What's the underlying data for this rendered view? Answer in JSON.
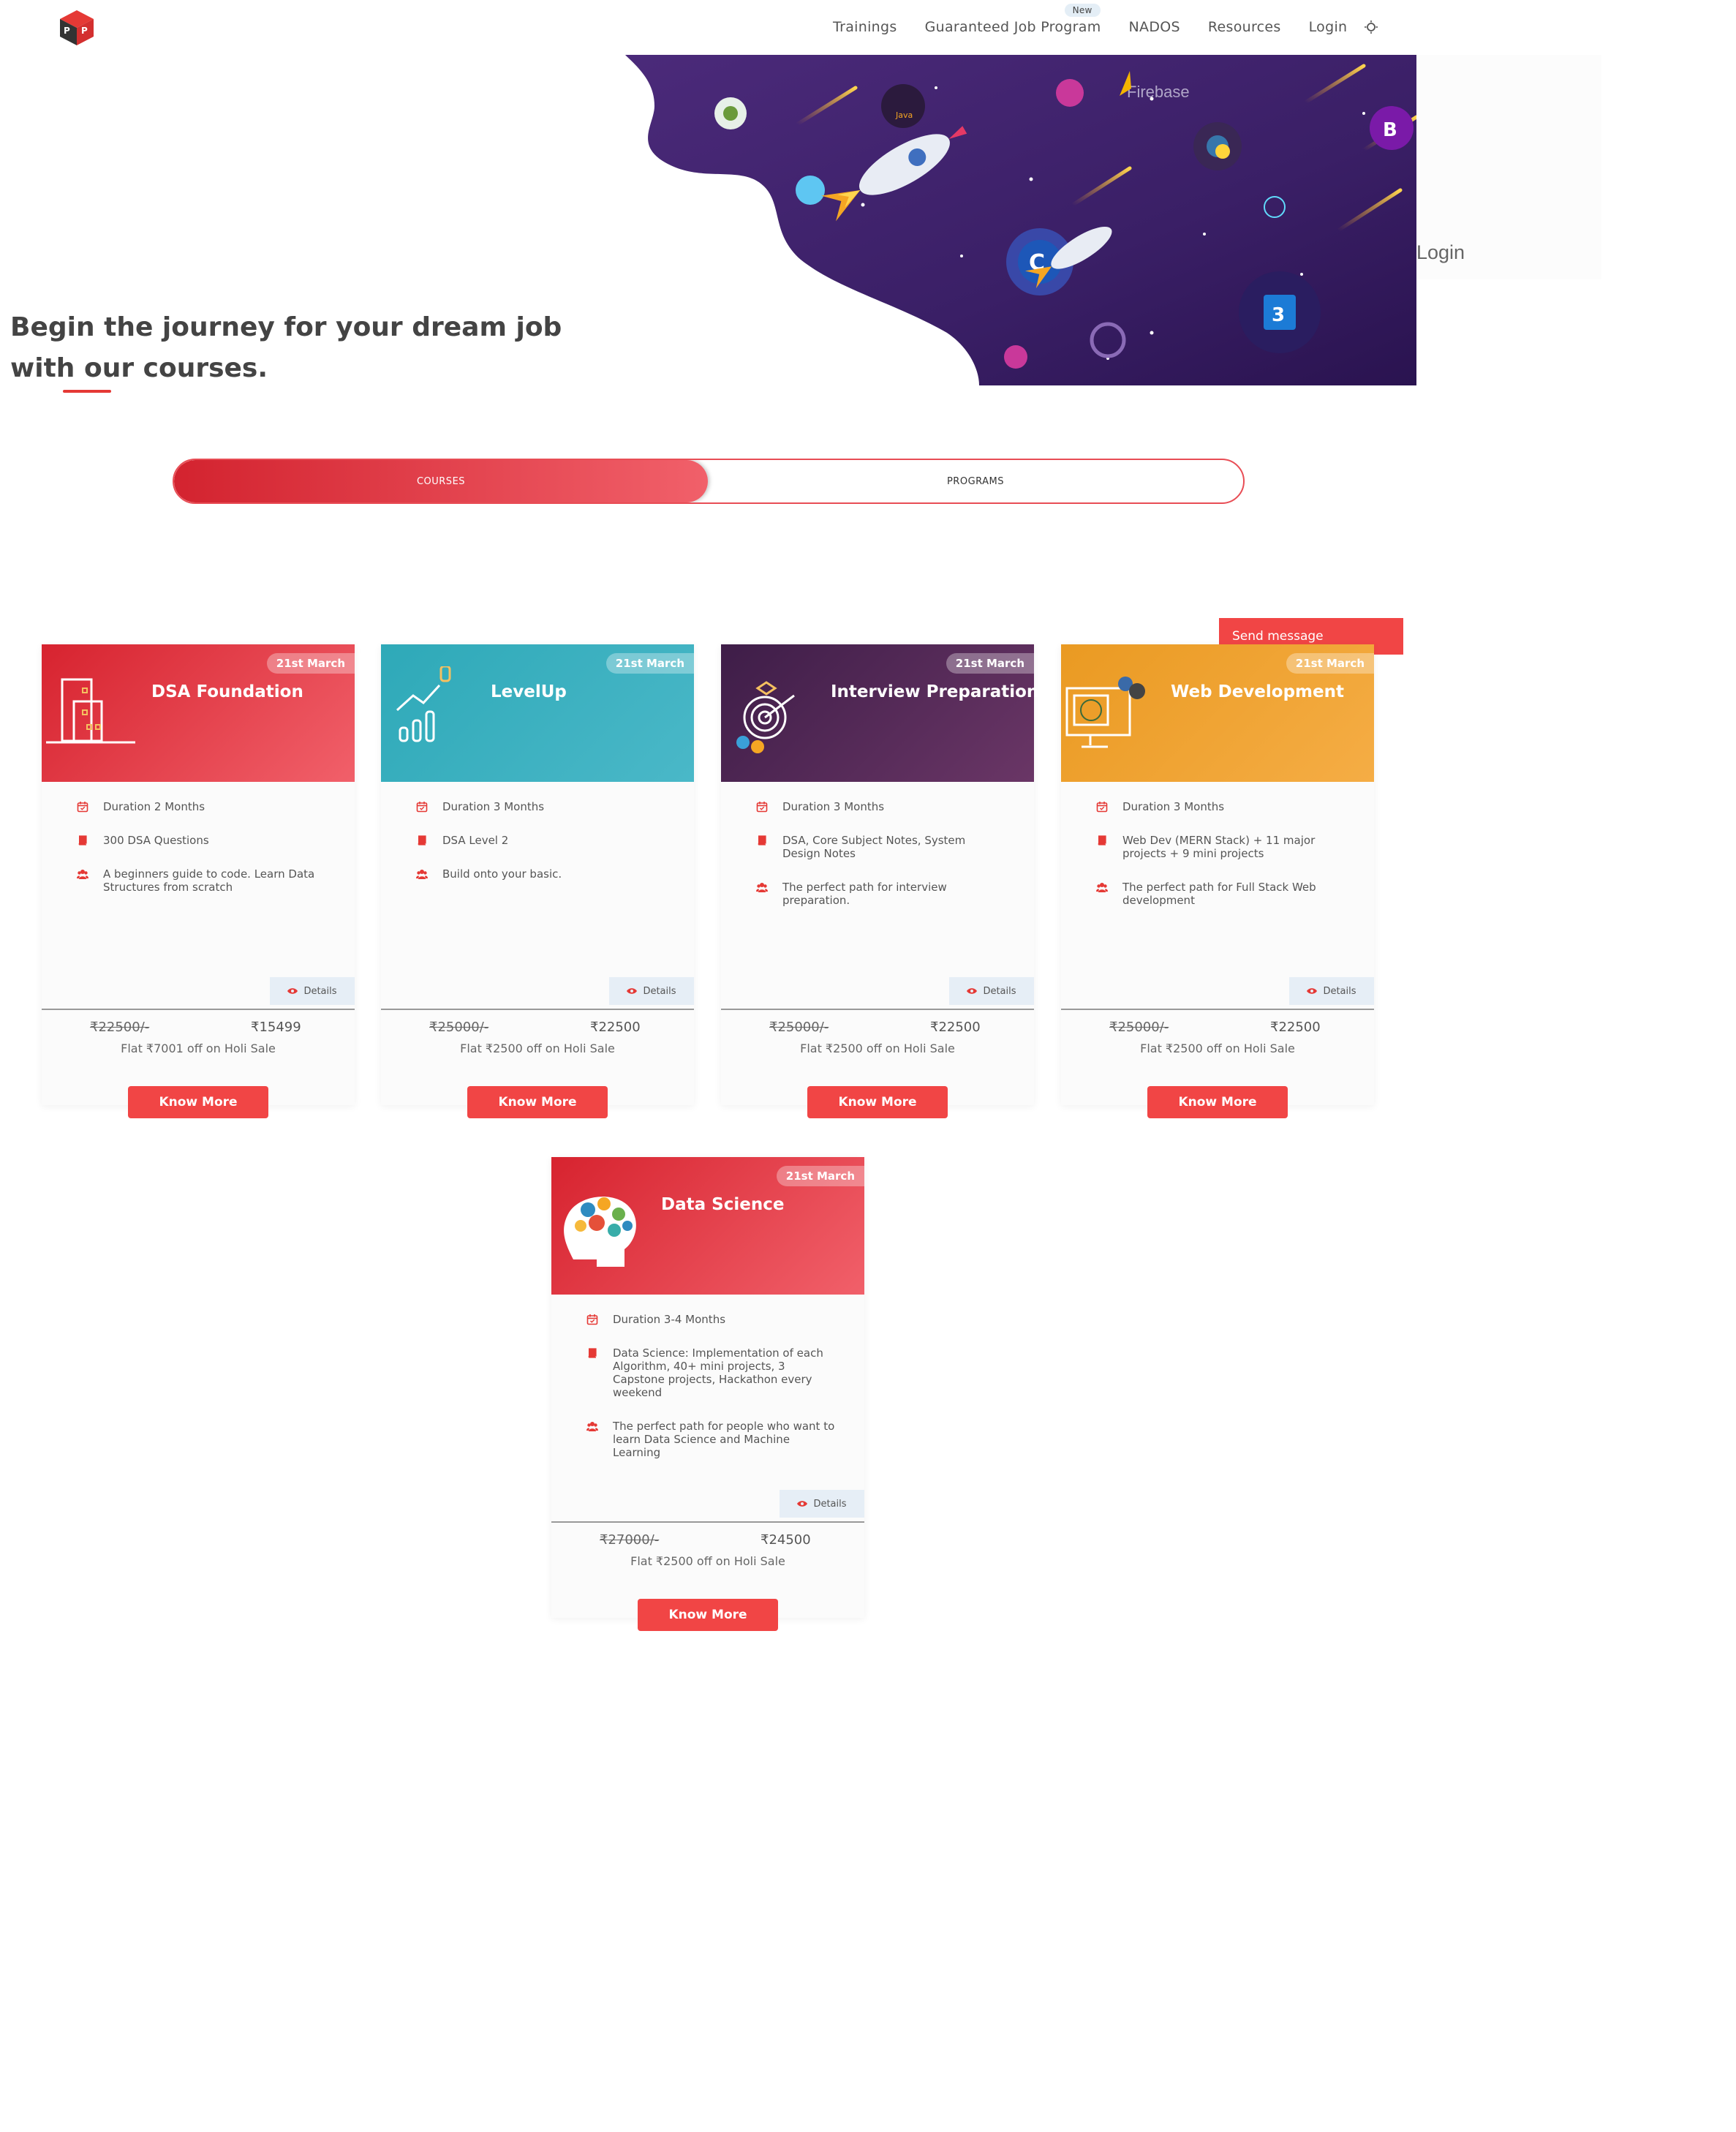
{
  "nav": {
    "items": [
      "Trainings",
      "Guaranteed Job Program",
      "NADOS",
      "Resources",
      "Login"
    ],
    "new_badge": "New"
  },
  "hero": {
    "title": "Begin the journey for your dream job with our courses.",
    "login_label": "Login",
    "firebase_label": "Firebase"
  },
  "toggle": {
    "courses": "COURSES",
    "programs": "PROGRAMS",
    "active": "COURSES"
  },
  "send_message": "Send message",
  "colors": {
    "accent": "#f14545",
    "dsa": "#e03a46",
    "levelup": "#3aafbf",
    "interview": "#5a2c5a",
    "webdev": "#f0a030",
    "datascience": "#e03a46"
  },
  "courses": [
    {
      "title": "DSA Foundation",
      "date": "21st March",
      "icon": "building-icon",
      "features": [
        {
          "icon": "calendar-icon",
          "text": "Duration 2 Months"
        },
        {
          "icon": "book-icon",
          "text": "300 DSA Questions"
        },
        {
          "icon": "users-icon",
          "text": "A beginners guide to code. Learn Data Structures from scratch"
        }
      ],
      "details": "Details",
      "old_price": "₹22500/-",
      "new_price": "₹15499",
      "offer": "Flat ₹7001 off on Holi Sale",
      "cta": "Know More"
    },
    {
      "title": "LevelUp",
      "date": "21st March",
      "icon": "growth-chart-icon",
      "features": [
        {
          "icon": "calendar-icon",
          "text": "Duration 3 Months"
        },
        {
          "icon": "book-icon",
          "text": "DSA Level 2"
        },
        {
          "icon": "users-icon",
          "text": "Build onto your basic."
        }
      ],
      "details": "Details",
      "old_price": "₹25000/-",
      "new_price": "₹22500",
      "offer": "Flat ₹2500 off on Holi Sale",
      "cta": "Know More"
    },
    {
      "title": "Interview Preparation",
      "date": "21st March",
      "icon": "target-icon",
      "features": [
        {
          "icon": "calendar-icon",
          "text": "Duration 3 Months"
        },
        {
          "icon": "book-icon",
          "text": "DSA, Core Subject Notes, System Design Notes"
        },
        {
          "icon": "users-icon",
          "text": "The perfect path for interview preparation."
        }
      ],
      "details": "Details",
      "old_price": "₹25000/-",
      "new_price": "₹22500",
      "offer": "Flat ₹2500 off on Holi Sale",
      "cta": "Know More"
    },
    {
      "title": "Web Development",
      "date": "21st March",
      "icon": "monitor-globe-icon",
      "features": [
        {
          "icon": "calendar-icon",
          "text": "Duration 3 Months"
        },
        {
          "icon": "book-icon",
          "text": "Web Dev (MERN Stack) + 11 major projects + 9 mini projects"
        },
        {
          "icon": "users-icon",
          "text": "The perfect path for Full Stack Web development"
        }
      ],
      "details": "Details",
      "old_price": "₹25000/-",
      "new_price": "₹22500",
      "offer": "Flat ₹2500 off on Holi Sale",
      "cta": "Know More"
    },
    {
      "title": "Data Science",
      "date": "21st March",
      "icon": "brain-gears-icon",
      "features": [
        {
          "icon": "calendar-icon",
          "text": "Duration 3-4 Months"
        },
        {
          "icon": "book-icon",
          "text": "Data Science: Implementation of each Algorithm, 40+ mini projects, 3 Capstone projects, Hackathon every weekend"
        },
        {
          "icon": "users-icon",
          "text": "The perfect path for people who want to learn Data Science and Machine Learning"
        }
      ],
      "details": "Details",
      "old_price": "₹27000/-",
      "new_price": "₹24500",
      "offer": "Flat ₹2500 off on Holi Sale",
      "cta": "Know More"
    }
  ]
}
